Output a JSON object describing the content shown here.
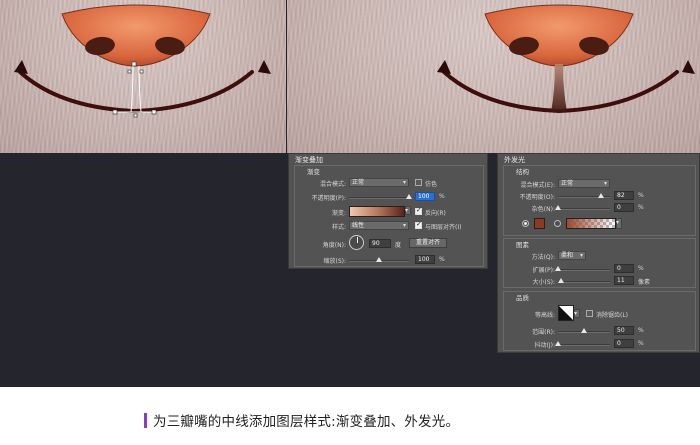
{
  "gradient_overlay": {
    "title": "渐变叠加",
    "section": "渐变",
    "blend_mode_label": "混合模式:",
    "blend_mode_value": "正常",
    "dither_label": "仿色",
    "opacity_label": "不透明度(P):",
    "opacity_value": "100",
    "opacity_unit": "%",
    "gradient_label": "渐变:",
    "reverse_label": "反向(R)",
    "reverse_checked": true,
    "style_label": "样式:",
    "style_value": "线性",
    "align_label": "与图层对齐(I)",
    "align_checked": true,
    "angle_label": "角度(N):",
    "angle_value": "90",
    "angle_unit": "度",
    "reset_align_button": "重置对齐",
    "scale_label": "缩放(S):",
    "scale_value": "100",
    "scale_unit": "%"
  },
  "outer_glow": {
    "title": "外发光",
    "structure_section": "结构",
    "blend_mode_label": "混合模式(E):",
    "blend_mode_value": "正常",
    "opacity_label": "不透明度(O):",
    "opacity_value": "82",
    "opacity_unit": "%",
    "noise_label": "杂色(N):",
    "noise_value": "0",
    "noise_unit": "%",
    "elements_section": "图素",
    "technique_label": "方法(Q):",
    "technique_value": "柔和",
    "spread_label": "扩展(P):",
    "spread_value": "0",
    "spread_unit": "%",
    "size_label": "大小(S):",
    "size_value": "11",
    "size_unit": "像素",
    "quality_section": "品质",
    "contour_label": "等高线:",
    "antialias_label": "消除锯齿(L)",
    "range_label": "范围(R):",
    "range_value": "50",
    "range_unit": "%",
    "jitter_label": "抖动(J):",
    "jitter_value": "0",
    "jitter_unit": "%"
  },
  "colors": {
    "canvas_bg": "#25262d",
    "panel_bg": "#535353",
    "glow_color": "#8a3b22",
    "accent": "#8a3ec8",
    "nose": "#d9744a"
  },
  "caption": {
    "text": "为三瓣嘴的中线添加图层样式:渐变叠加、外发光。"
  }
}
